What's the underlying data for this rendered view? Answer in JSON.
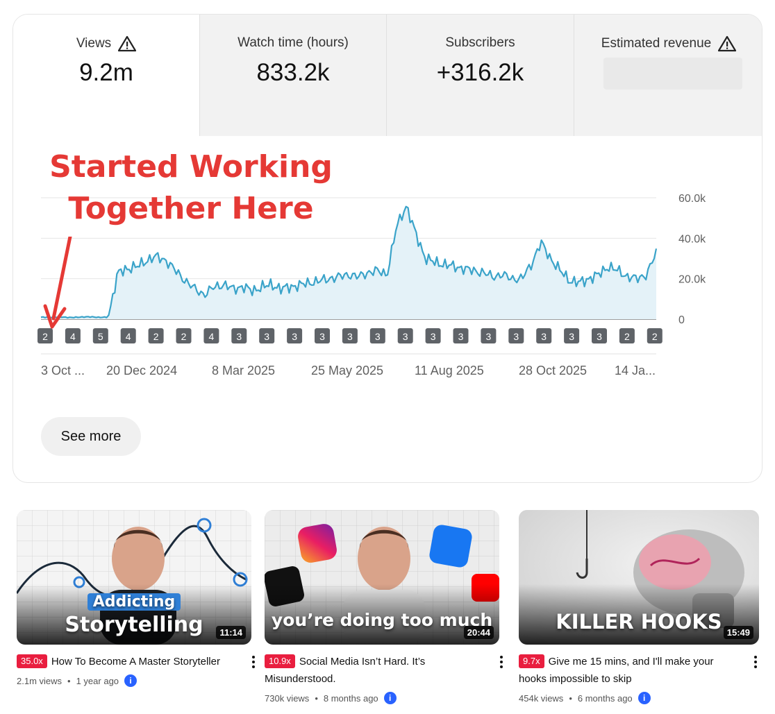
{
  "metrics": [
    {
      "label": "Views",
      "value": "9.2m",
      "warning": true
    },
    {
      "label": "Watch time (hours)",
      "value": "833.2k",
      "warning": false
    },
    {
      "label": "Subscribers",
      "value": "+316.2k",
      "warning": false
    },
    {
      "label": "Estimated revenue",
      "value": "",
      "warning": true,
      "hidden": true
    }
  ],
  "annotation": {
    "line1": "Started Working",
    "line2": "Together Here"
  },
  "see_more_label": "See more",
  "colors": {
    "line": "#3aa3c9",
    "fill": "#e4f2f8",
    "accent_red": "#e53935",
    "badge": "#e91e3f"
  },
  "chart_data": {
    "type": "area",
    "x_tick_labels": [
      "3 Oct ...",
      "20 Dec 2024",
      "8 Mar 2025",
      "25 May 2025",
      "11 Aug 2025",
      "28 Oct 2025",
      "14 Ja..."
    ],
    "y_tick_labels": [
      "60.0k",
      "40.0k",
      "20.0k",
      "0"
    ],
    "ylim": [
      0,
      60000
    ],
    "grid": true,
    "y_axis_side": "right",
    "upload_markers": [
      "2",
      "4",
      "5",
      "4",
      "2",
      "2",
      "4",
      "3",
      "3",
      "3",
      "3",
      "3",
      "3",
      "3",
      "3",
      "3",
      "3",
      "3",
      "3",
      "3",
      "3",
      "2",
      "2"
    ],
    "keypoints": [
      [
        0,
        1000
      ],
      [
        1,
        900
      ],
      [
        2,
        1100
      ],
      [
        3,
        800
      ],
      [
        4,
        1000
      ],
      [
        5,
        1200
      ],
      [
        6,
        900
      ],
      [
        7,
        1000
      ],
      [
        8,
        23000
      ],
      [
        9,
        25000
      ],
      [
        10,
        26000
      ],
      [
        11,
        29000
      ],
      [
        12,
        31000
      ],
      [
        13,
        29000
      ],
      [
        14,
        24000
      ],
      [
        15,
        19000
      ],
      [
        16,
        15000
      ],
      [
        17,
        12000
      ],
      [
        18,
        16000
      ],
      [
        19,
        17000
      ],
      [
        20,
        15000
      ],
      [
        21,
        16000
      ],
      [
        22,
        14000
      ],
      [
        23,
        16000
      ],
      [
        24,
        17000
      ],
      [
        25,
        15000
      ],
      [
        26,
        16000
      ],
      [
        27,
        17000
      ],
      [
        28,
        18000
      ],
      [
        29,
        19000
      ],
      [
        30,
        20000
      ],
      [
        31,
        21000
      ],
      [
        32,
        22000
      ],
      [
        33,
        21000
      ],
      [
        34,
        23000
      ],
      [
        35,
        24000
      ],
      [
        36,
        22000
      ],
      [
        37,
        46000
      ],
      [
        38,
        56000
      ],
      [
        39,
        42000
      ],
      [
        40,
        30000
      ],
      [
        41,
        28000
      ],
      [
        42,
        27000
      ],
      [
        43,
        26000
      ],
      [
        44,
        25000
      ],
      [
        45,
        24000
      ],
      [
        46,
        23000
      ],
      [
        47,
        21000
      ],
      [
        48,
        22000
      ],
      [
        49,
        20000
      ],
      [
        50,
        20000
      ],
      [
        51,
        27000
      ],
      [
        52,
        38000
      ],
      [
        53,
        30000
      ],
      [
        54,
        24000
      ],
      [
        55,
        19000
      ],
      [
        56,
        18000
      ],
      [
        57,
        20000
      ],
      [
        58,
        22000
      ],
      [
        59,
        26000
      ],
      [
        60,
        24000
      ],
      [
        61,
        21000
      ],
      [
        62,
        20000
      ],
      [
        63,
        22000
      ],
      [
        64,
        33000
      ]
    ]
  },
  "videos": [
    {
      "multiplier": "35.0x",
      "title": "How To Become A Master Storyteller",
      "views": "2.1m views",
      "age": "1 year ago",
      "duration": "11:14",
      "thumb_line1": "Addicting",
      "thumb_line2": "Storytelling"
    },
    {
      "multiplier": "10.9x",
      "title": "Social Media Isn’t Hard. It’s Misunderstood.",
      "views": "730k views",
      "age": "8 months ago",
      "duration": "20:44",
      "thumb_line1": "you’re doing too much",
      "thumb_line2": ""
    },
    {
      "multiplier": "9.7x",
      "title": "Give me 15 mins, and I'll make your hooks impossible to skip",
      "views": "454k views",
      "age": "6 months ago",
      "duration": "15:49",
      "thumb_line1": "KILLER HOOKS",
      "thumb_line2": ""
    }
  ],
  "separator": "•",
  "info_glyph": "i"
}
